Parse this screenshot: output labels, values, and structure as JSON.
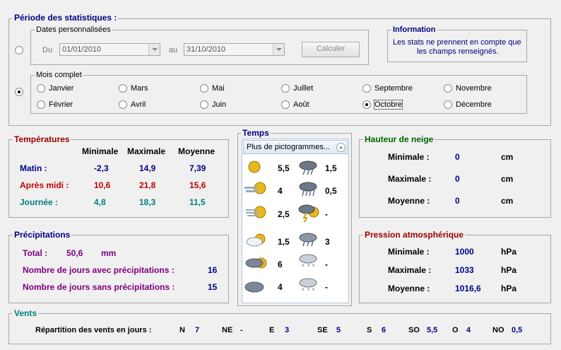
{
  "periode": {
    "title": "Période des statistiques :",
    "dates_title": "Dates personnalisées",
    "du_label": "Du",
    "du_value": "01/01/2010",
    "au_label": "au",
    "au_value": "31/10/2010",
    "calc_label": "Calculer",
    "mois_title": "Mois complet",
    "months": [
      "Janvier",
      "Mars",
      "Mai",
      "Juillet",
      "Septembre",
      "Novembre",
      "Février",
      "Avril",
      "Juin",
      "Août",
      "Octobre",
      "Décembre"
    ],
    "selected_month": "Octobre"
  },
  "information": {
    "title": "Information",
    "line1": "Les stats ne prennent en compte que",
    "line2": "les champs renseignés."
  },
  "temperatures": {
    "title": "Températures",
    "col_min": "Minimale",
    "col_max": "Maximale",
    "col_moy": "Moyenne",
    "rows": [
      {
        "label": "Matin :",
        "min": "-2,3",
        "max": "14,9",
        "moy": "7,39"
      },
      {
        "label": "Après midi :",
        "min": "10,6",
        "max": "21,8",
        "moy": "15,6"
      },
      {
        "label": "Journée :",
        "min": "4,8",
        "max": "18,3",
        "moy": "11,5"
      }
    ]
  },
  "temps": {
    "title": "Temps",
    "dropdown": "Plus de pictogrammes...",
    "left": [
      {
        "icon": "sun-icon",
        "value": "5,5"
      },
      {
        "icon": "sun-fog-icon",
        "value": "4"
      },
      {
        "icon": "sun-fog-cloud-icon",
        "value": "2,5"
      },
      {
        "icon": "cloud-sun-icon",
        "value": "1,5"
      },
      {
        "icon": "dark-cloud-sun-icon",
        "value": "6"
      },
      {
        "icon": "dark-cloud-icon",
        "value": "4"
      }
    ],
    "right": [
      {
        "icon": "storm-icon",
        "value": "1,5"
      },
      {
        "icon": "heavy-rain-icon",
        "value": "0,5"
      },
      {
        "icon": "thunder-sun-icon",
        "value": "-"
      },
      {
        "icon": "rain-icon",
        "value": "3"
      },
      {
        "icon": "snow-rain-icon",
        "value": "-"
      },
      {
        "icon": "snow-icon",
        "value": "-"
      }
    ]
  },
  "neige": {
    "title": "Hauteur de neige",
    "rows": [
      {
        "label": "Minimale :",
        "value": "0",
        "unit": "cm"
      },
      {
        "label": "Maximale :",
        "value": "0",
        "unit": "cm"
      },
      {
        "label": "Moyenne :",
        "value": "0",
        "unit": "cm"
      }
    ]
  },
  "precipitations": {
    "title": "Précipitations",
    "total_label": "Total :",
    "total_value": "50,6",
    "total_unit": "mm",
    "avec_label": "Nombre de jours avec précipitations :",
    "avec_value": "16",
    "sans_label": "Nombre de jours sans précipitations :",
    "sans_value": "15"
  },
  "pression": {
    "title": "Pression atmosphérique",
    "rows": [
      {
        "label": "Minimale :",
        "value": "1000",
        "unit": "hPa"
      },
      {
        "label": "Maximale :",
        "value": "1033",
        "unit": "hPa"
      },
      {
        "label": "Moyenne :",
        "value": "1016,6",
        "unit": "hPa"
      }
    ]
  },
  "vents": {
    "title": "Vents",
    "label": "Répartition des vents en jours :",
    "dirs": [
      {
        "dir": "N",
        "value": "7"
      },
      {
        "dir": "NE",
        "value": "-"
      },
      {
        "dir": "E",
        "value": "3"
      },
      {
        "dir": "SE",
        "value": "5"
      },
      {
        "dir": "S",
        "value": "6"
      },
      {
        "dir": "SO",
        "value": "5,5"
      },
      {
        "dir": "O",
        "value": "4"
      },
      {
        "dir": "NO",
        "value": "0,5"
      }
    ]
  }
}
